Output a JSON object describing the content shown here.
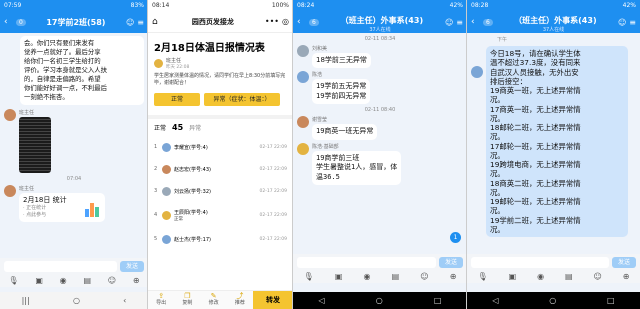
{
  "panel1": {
    "status_time": "07:59",
    "status_right": "83%",
    "back_count": "0",
    "title": "17学前2班(58)",
    "msg1_lines": [
      "会。你们只有要们来发有",
      "觉养一点就好了。最后分享",
      "给你们一名初三学生给打的",
      "评价。学习本身就是父入人扶",
      "的，自律是走偏路的。希望",
      "你们能好好调一点，不利最后",
      "一刻絶不拖杏。"
    ],
    "sender1": "班主任",
    "time_mid": "07:04",
    "sender2": "班主任",
    "card_title": "2月18日 统计",
    "card_sub1": "· 正在统计",
    "card_sub2": "· 点此参与",
    "send_label": "发送"
  },
  "panel2": {
    "status_time": "08:14",
    "status_right": "100%",
    "header_title": "园西页发接龙",
    "doc_title": "2月18日体温日报情况表",
    "author_name": "班主任",
    "author_time": "昨天 22:08",
    "desc": "学生居家测量体温的情况，请同学们在早上8:30分前填写完毕，谢谢配合！",
    "btn_normal": "正常",
    "btn_abnormal": "异常（症状：体温：）",
    "list_label": "正常",
    "list_count": "45",
    "list_other": "异常",
    "rows": [
      {
        "num": "1",
        "name": "李耀宣(学号:4)",
        "note": "",
        "time": "02-17 22:09"
      },
      {
        "num": "2",
        "name": "赵志宏(学号:43)",
        "note": "",
        "time": "02-17 22:09"
      },
      {
        "num": "3",
        "name": "刘云扬(学号:32)",
        "note": "",
        "time": "02-17 22:09"
      },
      {
        "num": "4",
        "name": "王辰阳(学号:4)",
        "note": "正常",
        "time": "02-17 22:09"
      },
      {
        "num": "5",
        "name": "赵士杰(学号:17)",
        "note": "",
        "time": "02-17 22:09"
      }
    ],
    "nav_items": [
      "导出",
      "复制",
      "修改",
      "推荐"
    ],
    "forward_label": "转发"
  },
  "panel3": {
    "status_time": "08:24",
    "status_right": "42%",
    "back_count": "6",
    "title": "（班主任）外事系(43)",
    "subtitle": "37人在线",
    "ts1": "02-11 08:34",
    "sender1": "刘和美",
    "msg1": "18学前三无异常",
    "sender2": "陈浩",
    "msg2_lines": [
      "19学前五无异常",
      "19学前四无异常"
    ],
    "ts2": "02-11 08:40",
    "sender3": "谢雪莹",
    "msg3": "19商英一班无异常",
    "sender4": "陈浩·基础部",
    "msg4_lines": [
      "19商学前三班",
      "学生暑整说1人，感冒，体",
      "温36.5"
    ],
    "unread": "1",
    "send_label": "发送"
  },
  "panel4": {
    "status_time": "08:28",
    "status_right": "42%",
    "back_count": "6",
    "title": "（班主任）外事系(43)",
    "subtitle": "37人在线",
    "ts1": "下午",
    "msg_lines": [
      "今日18号，请在确认学生体",
      "温不超过37.3度，没有同来",
      "自武汉人员接触，无外出安",
      "排后接空：",
      "19商英一班，无上述异常情",
      "况。",
      "17商英一班，无上述异常情",
      "况。",
      "18邮轮二班，无上述异常情",
      "况。",
      "17邮轮一班，无上述异常情",
      "况。",
      "19跨境电商，无上述异常情",
      "况。",
      "18商英二班，无上述异常情",
      "况。",
      "19邮轮一班，无上述异常情",
      "况。",
      "19学前二班，无上述异常情",
      "况。"
    ],
    "send_label": "发送"
  }
}
